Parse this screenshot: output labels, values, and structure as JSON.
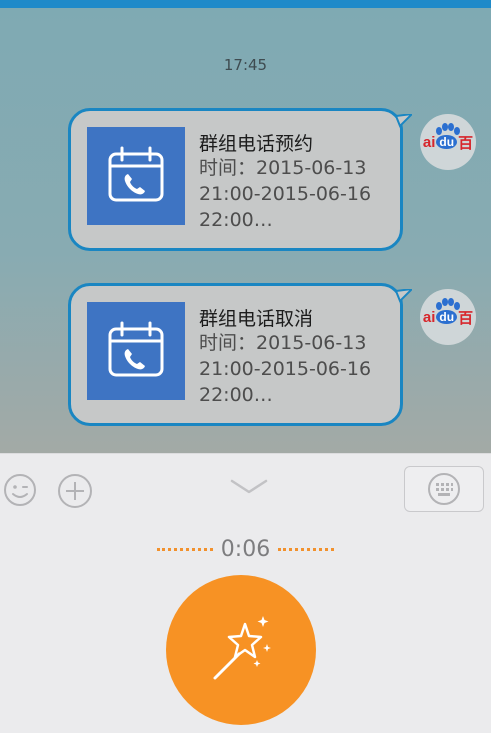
{
  "chat": {
    "timestamp": "17:45",
    "messages": [
      {
        "title": "群组电话预约",
        "body": "时间：2015-06-13 21:00-2015-06-16 22:00…",
        "icon": "calendar-phone-icon"
      },
      {
        "title": "群组电话取消",
        "body": "时间：2015-06-13 21:00-2015-06-16 22:00…",
        "icon": "calendar-phone-icon"
      }
    ],
    "avatar": {
      "part1": "ai",
      "part2": "du",
      "part3": "百"
    }
  },
  "toolbar": {
    "emoji_icon": "emoji-icon",
    "plus_icon": "plus-circle-icon",
    "collapse_icon": "chevron-down-icon",
    "keyboard_icon": "keyboard-icon"
  },
  "voice": {
    "elapsed": "0:06",
    "record_icon": "magic-wand-icon"
  },
  "colors": {
    "accent_orange": "#f79224",
    "bubble_border": "#1a86c2",
    "card_blue": "#3e74c3",
    "brand_bar": "#1f8ac9"
  }
}
